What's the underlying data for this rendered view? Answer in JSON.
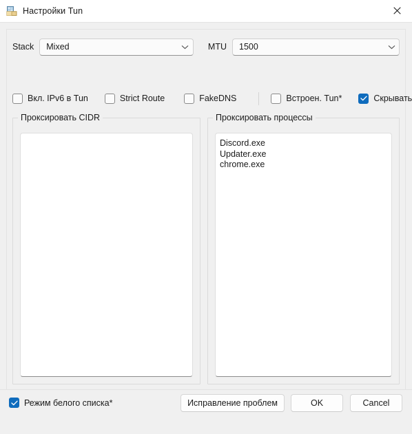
{
  "window": {
    "title": "Настройки Tun",
    "icon": "tun-settings-icon",
    "close_icon": "close-icon"
  },
  "settings": {
    "stack": {
      "label": "Stack",
      "value": "Mixed",
      "chevron_icon": "chevron-down-icon"
    },
    "mtu": {
      "label": "MTU",
      "value": "1500",
      "chevron_icon": "chevron-down-icon"
    }
  },
  "checkboxes": [
    {
      "name": "ipv6-in-tun",
      "label": "Вкл. IPv6 в Tun",
      "checked": false
    },
    {
      "name": "strict-route",
      "label": "Strict Route",
      "checked": false
    },
    {
      "name": "fakedns",
      "label": "FakeDNS",
      "checked": false
    },
    {
      "name": "builtin-tun",
      "label": "Встроен. Tun*",
      "checked": false
    },
    {
      "name": "hide-window",
      "label": "Скрывать окно",
      "checked": true
    }
  ],
  "groups": {
    "cidr": {
      "title": "Проксировать CIDR",
      "items": []
    },
    "processes": {
      "title": "Проксировать процессы",
      "items": [
        "Discord.exe",
        "Updater.exe",
        "chrome.exe"
      ]
    }
  },
  "footer": {
    "whitelist_mode": {
      "label": "Режим белого списка*",
      "checked": true
    },
    "buttons": {
      "fix": "Исправление проблем",
      "ok": "OK",
      "cancel": "Cancel"
    }
  },
  "colors": {
    "accent": "#0f6cbd",
    "window_bg": "#f0f0f0",
    "titlebar_bg": "#ffffff",
    "field_bg": "#fbfbfb",
    "list_bg": "#ffffff",
    "text": "#1a1a1a",
    "border": "#dadada"
  }
}
